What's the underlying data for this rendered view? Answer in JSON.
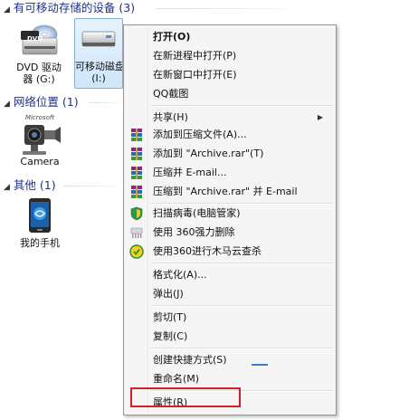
{
  "sections": {
    "removable": "有可移动存储的设备 (3)",
    "network": "网络位置 (1)",
    "other": "其他 (1)"
  },
  "items": {
    "dvd_line1": "DVD 驱动",
    "dvd_line2": "器 (G:)",
    "dvd_badge": "DVD",
    "removable_line1": "可移动磁盘",
    "removable_line2": "(I:)",
    "camera": "Camera",
    "camera_badge": "Microsoft",
    "phone": "我的手机"
  },
  "menu": {
    "open": "打开(O)",
    "open_new_process": "在新进程中打开(P)",
    "open_new_window": "在新窗口中打开(E)",
    "qq_screenshot": "QQ截图",
    "share": "共享(H)",
    "add_to_archive": "添加到压缩文件(A)...",
    "add_to_archive_rar": "添加到 \"Archive.rar\"(T)",
    "compress_email": "压缩并 E-mail...",
    "compress_rar_email": "压缩到 \"Archive.rar\" 并 E-mail",
    "scan_virus": "扫描病毒(电脑管家)",
    "force_delete_360": "使用 360强力删除",
    "trojan_scan_360": "使用360进行木马云查杀",
    "format": "格式化(A)...",
    "eject": "弹出(J)",
    "cut": "剪切(T)",
    "copy": "复制(C)",
    "create_shortcut": "创建快捷方式(S)",
    "rename": "重命名(M)",
    "properties": "属性(R)"
  },
  "colors": {
    "section_header": "#1e3287",
    "highlight_border": "#d3202a",
    "selection_border": "#84acdd"
  }
}
